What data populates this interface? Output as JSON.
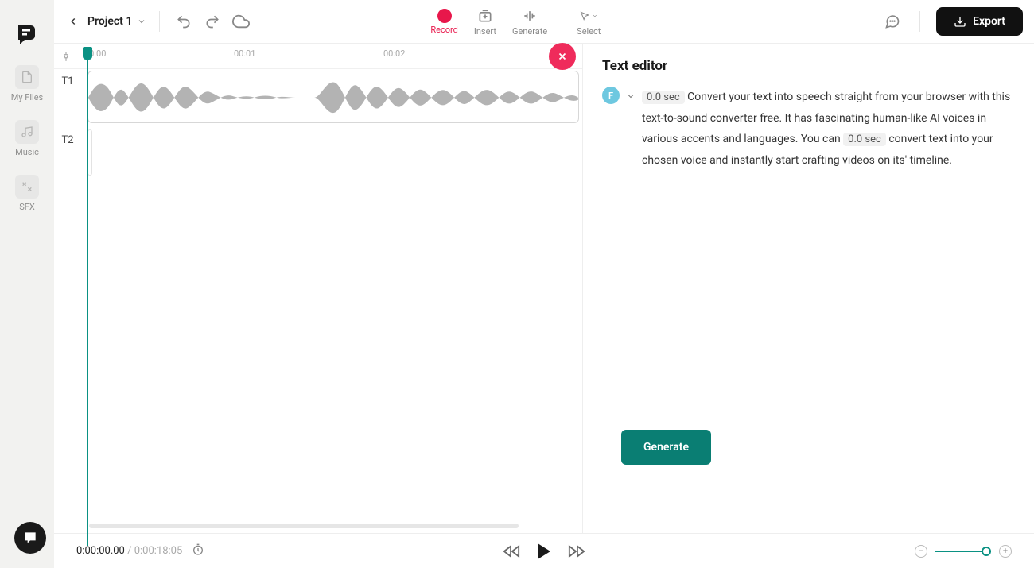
{
  "sidebar": {
    "items": [
      {
        "label": "My Files"
      },
      {
        "label": "Music"
      },
      {
        "label": "SFX"
      }
    ]
  },
  "project": {
    "name": "Project 1"
  },
  "toolbar": {
    "record": "Record",
    "insert": "Insert",
    "generate": "Generate",
    "select": "Select",
    "export": "Export"
  },
  "ruler": {
    "marks": [
      "00:00",
      "00:01",
      "00:02"
    ]
  },
  "tracks": {
    "t1": "T1",
    "t2": "T2"
  },
  "editor": {
    "title": "Text editor",
    "voice_letter": "F",
    "chip1": "0.0 sec",
    "part1": " Convert your text into speech straight from your browser with this text-to-sound converter free. It has fascinating human-like AI voices in various accents and languages. You can ",
    "chip2": "0.0 sec",
    "part2": " convert text into your chosen voice and instantly start crafting videos on its' timeline.",
    "generate_btn": "Generate"
  },
  "transport": {
    "current": "0:00:00.00",
    "sep": " / ",
    "duration": "0:00:18:05"
  }
}
